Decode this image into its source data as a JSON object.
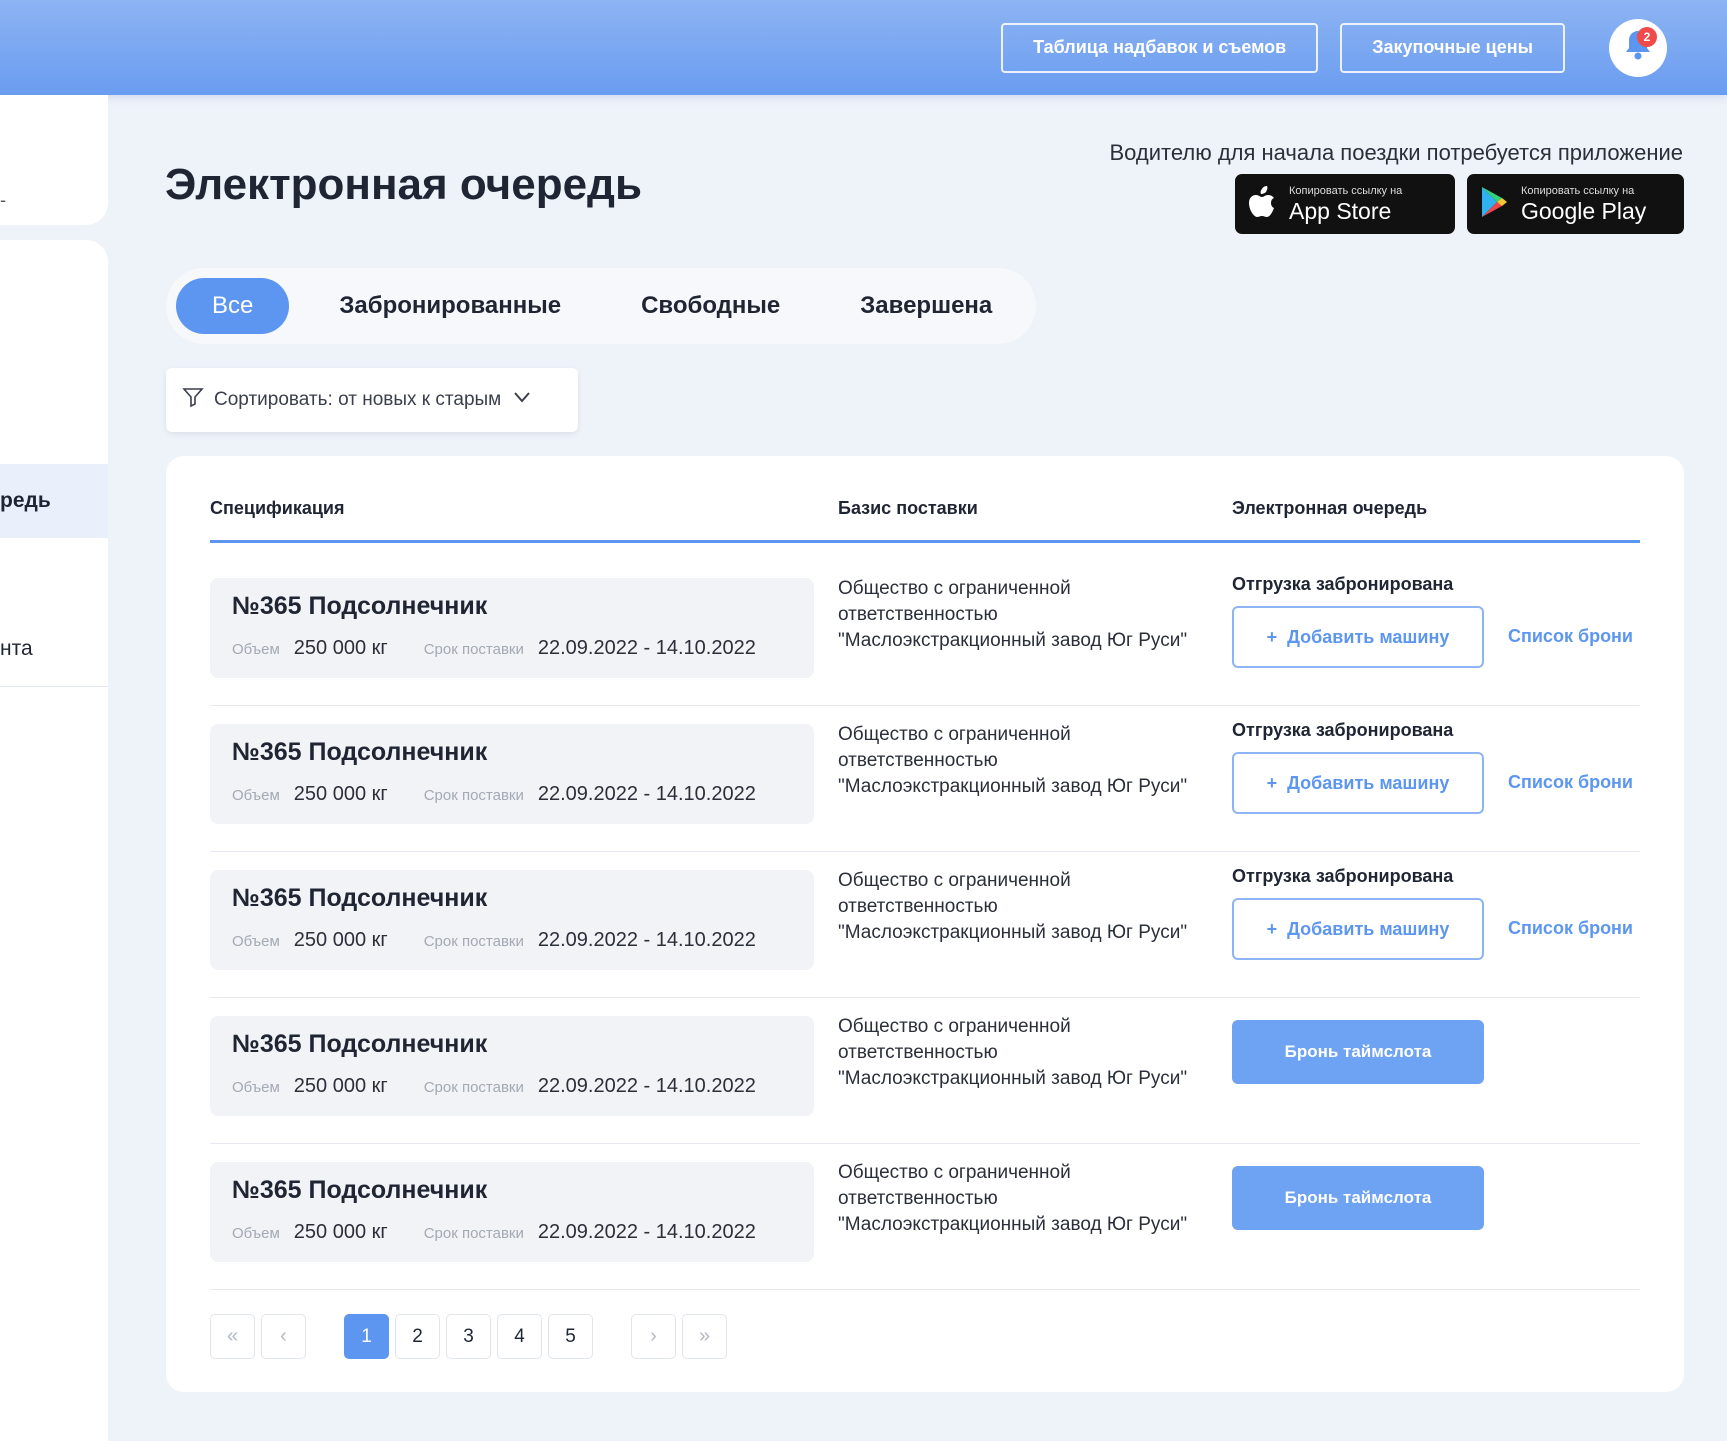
{
  "header": {
    "btn_markups": "Таблица надбавок и съемов",
    "btn_prices": "Закупочные цены",
    "notif_count": "2"
  },
  "sidebar": {
    "top_item": "-",
    "items": [
      "редь",
      "нта"
    ]
  },
  "page": {
    "title": "Электронная очередь",
    "app_note": "Водителю для начала поездки потребуется приложение",
    "appstore_small": "Копировать ссылку на",
    "appstore_big": "App Store",
    "gplay_small": "Копировать ссылку на",
    "gplay_big": "Google Play"
  },
  "tabs": [
    "Все",
    "Забронированные",
    "Свободные",
    "Завершена"
  ],
  "sort": {
    "label": "Сортировать: от новых к старым"
  },
  "table": {
    "headers": [
      "Спецификация",
      "Базис поставки",
      "Электронная очередь"
    ],
    "rows": [
      {
        "title": "№365 Подсолнечник",
        "vol_label": "Объем",
        "vol": "250 000 кг",
        "term_label": "Срок поставки",
        "term": "22.09.2022 - 14.10.2022",
        "basis1": "Общество с ограниченной",
        "basis2": "ответственностью",
        "basis3": "\"Маслоэкстракционный завод Юг Руси\"",
        "status": "Отгрузка забронирована",
        "add": "Добавить машину",
        "list": "Список брони"
      },
      {
        "title": "№365 Подсолнечник",
        "vol_label": "Объем",
        "vol": "250 000 кг",
        "term_label": "Срок поставки",
        "term": "22.09.2022 - 14.10.2022",
        "basis1": "Общество с ограниченной",
        "basis2": "ответственностью",
        "basis3": "\"Маслоэкстракционный завод Юг Руси\"",
        "status": "Отгрузка забронирована",
        "add": "Добавить машину",
        "list": "Список брони"
      },
      {
        "title": "№365 Подсолнечник",
        "vol_label": "Объем",
        "vol": "250 000 кг",
        "term_label": "Срок поставки",
        "term": "22.09.2022 - 14.10.2022",
        "basis1": "Общество с ограниченной",
        "basis2": "ответственностью",
        "basis3": "\"Маслоэкстракционный завод Юг Руси\"",
        "status": "Отгрузка забронирована",
        "add": "Добавить машину",
        "list": "Список брони"
      },
      {
        "title": "№365 Подсолнечник",
        "vol_label": "Объем",
        "vol": "250 000 кг",
        "term_label": "Срок поставки",
        "term": "22.09.2022 - 14.10.2022",
        "basis1": "Общество с ограниченной",
        "basis2": "ответственностью",
        "basis3": "\"Маслоэкстракционный завод Юг Руси\"",
        "slot": "Бронь таймслота"
      },
      {
        "title": "№365 Подсолнечник",
        "vol_label": "Объем",
        "vol": "250 000 кг",
        "term_label": "Срок поставки",
        "term": "22.09.2022 - 14.10.2022",
        "basis1": "Общество с ограниченной",
        "basis2": "ответственностью",
        "basis3": "\"Маслоэкстракционный завод Юг Руси\"",
        "slot": "Бронь таймслота"
      }
    ]
  },
  "pager": {
    "first": "«",
    "prev": "‹",
    "pages": [
      "1",
      "2",
      "3",
      "4",
      "5"
    ],
    "next": "›",
    "last": "»",
    "current": "1"
  }
}
